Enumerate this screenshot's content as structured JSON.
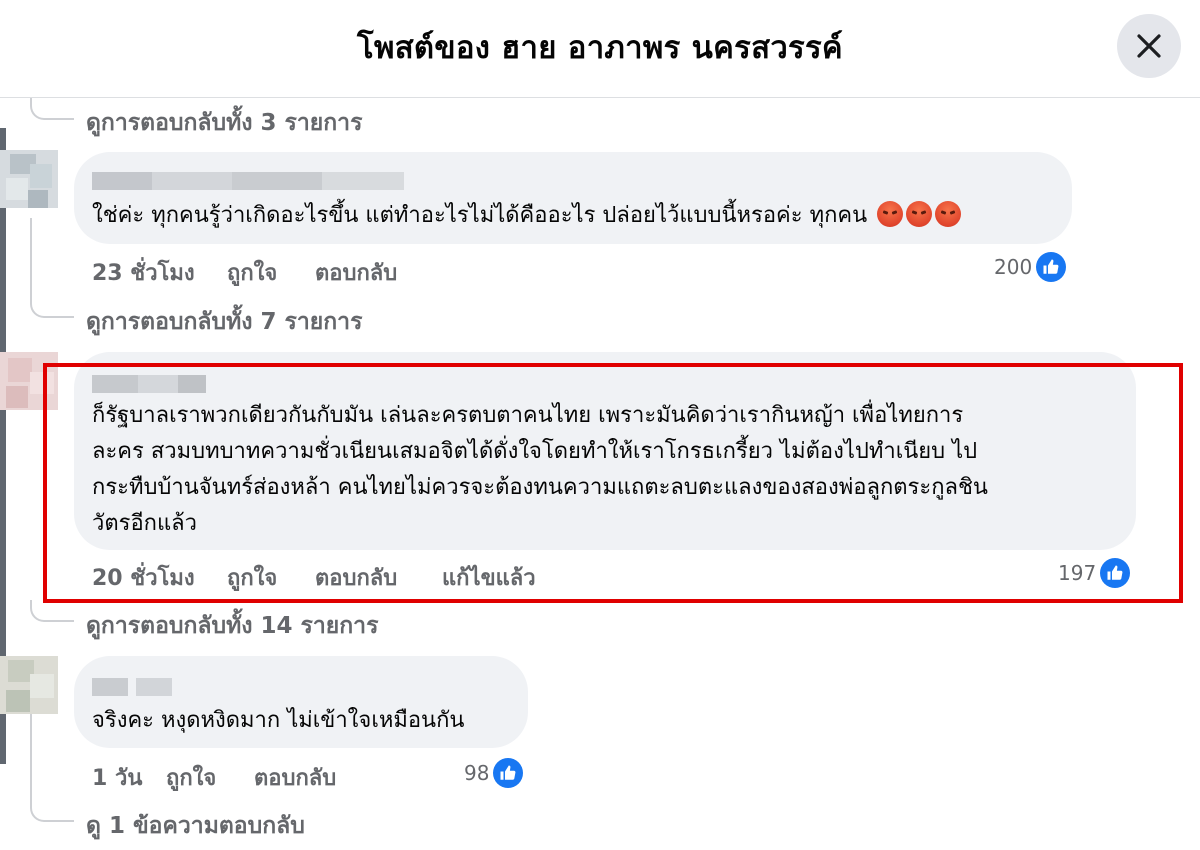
{
  "header": {
    "title": "โพสต์ของ ฮาย อาภาพร นครสวรรค์"
  },
  "threads": [
    {
      "view_replies": "ดูการตอบกลับทั้ง 3 รายการ"
    },
    {
      "view_replies": "ดูการตอบกลับทั้ง 7 รายการ"
    },
    {
      "view_replies": "ดูการตอบกลับทั้ง 14 รายการ"
    },
    {
      "view_replies": "ดู 1 ข้อความตอบกลับ"
    }
  ],
  "comments": [
    {
      "text": "ใช่ค่ะ ทุกคนรู้ว่าเกิดอะไรขึ้น แต่ทำอะไรไม่ได้คืออะไร ปล่อยไว้แบบนี้หรอค่ะ ทุกคน",
      "emoji": [
        "pouting-face-emoji",
        "pouting-face-emoji",
        "pouting-face-emoji"
      ],
      "time": "23 ชั่วโมง",
      "like_label": "ถูกใจ",
      "reply_label": "ตอบกลับ",
      "likes": "200"
    },
    {
      "lines": [
        "ก็รัฐบาลเราพวกเดียวกันกับมัน เล่นละครตบตาคนไทย เพราะมันคิดว่าเรากินหญ้า เพื่อไทยการ",
        "ละคร สวมบทบาทความชั่วเนียนเสมอจิตได้ดั่งใจโดยทำให้เราโกรธเกรี้ยว ไม่ต้องไปทำเนียบ ไป",
        "กระทืบบ้านจันทร์ส่องหล้า คนไทยไม่ควรจะต้องทนความแถตะลบตะแลงของสองพ่อลูกตระกูลชิน",
        "วัตรอีกแล้ว"
      ],
      "time": "20 ชั่วโมง",
      "like_label": "ถูกใจ",
      "reply_label": "ตอบกลับ",
      "edited_label": "แก้ไขแล้ว",
      "likes": "197"
    },
    {
      "text": "จริงคะ หงุดหงิดมาก ไม่เข้าใจเหมือนกัน",
      "time": "1 วัน",
      "like_label": "ถูกใจ",
      "reply_label": "ตอบกลับ",
      "likes": "98"
    }
  ]
}
